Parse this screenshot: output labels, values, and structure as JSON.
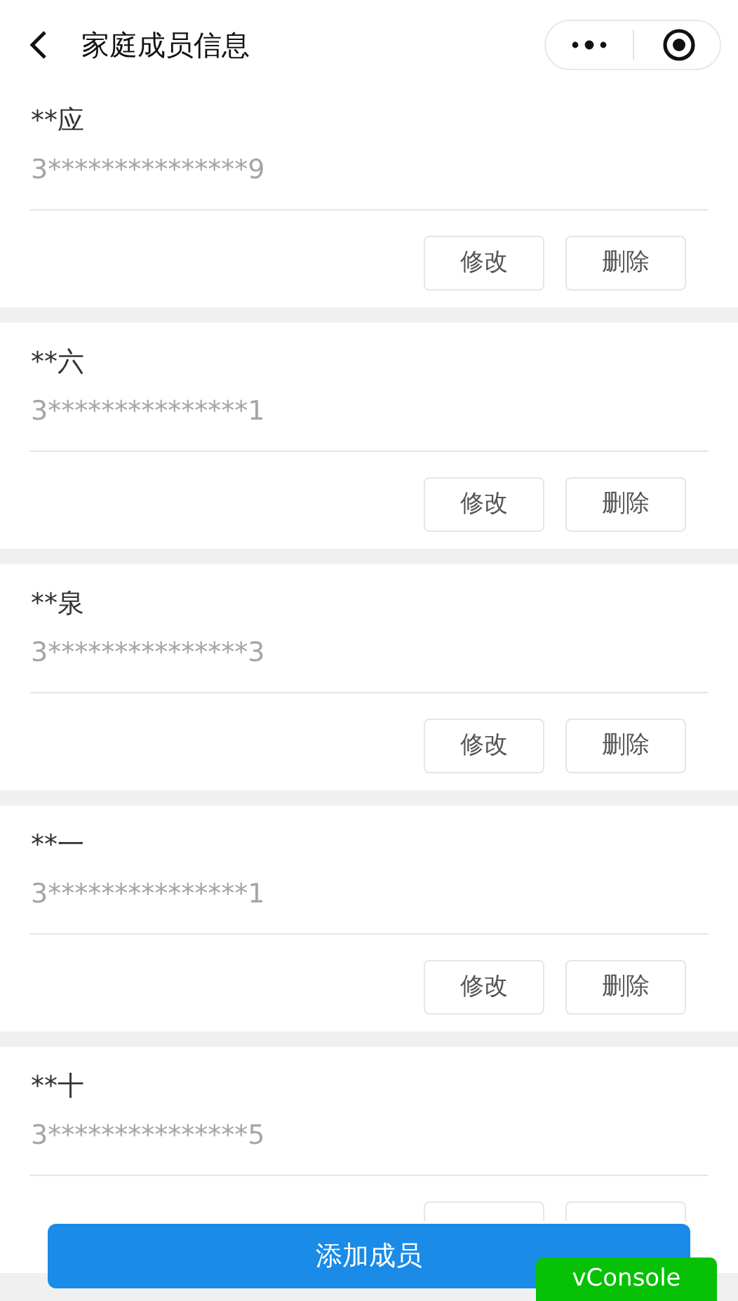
{
  "header": {
    "title": "家庭成员信息"
  },
  "members": [
    {
      "name": "**应",
      "id_number": "3***************9",
      "actions": [
        "修改",
        "删除"
      ]
    },
    {
      "name": "**六",
      "id_number": "3***************1",
      "actions": [
        "修改",
        "删除"
      ]
    },
    {
      "name": "**泉",
      "id_number": "3***************3",
      "actions": [
        "修改",
        "删除"
      ]
    },
    {
      "name": "**一",
      "id_number": "3***************1",
      "actions": [
        "修改",
        "删除"
      ]
    },
    {
      "name": "**十",
      "id_number": "3***************5",
      "actions_covered": true
    }
  ],
  "add_button": "添加成员",
  "vconsole": "vConsole"
}
